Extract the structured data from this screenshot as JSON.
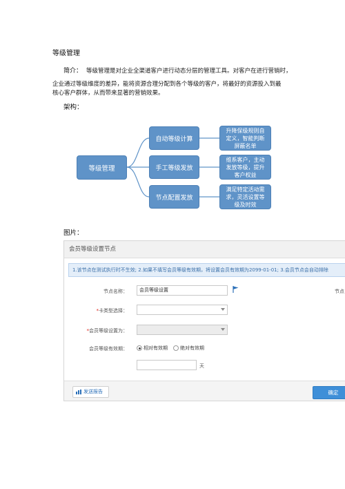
{
  "document": {
    "heading": "等级管理",
    "intro_label": "简介：",
    "intro_text": "等级管理是对企业全渠道客户进行动态分层的管理工具。对客户在进行营销时，",
    "body_lines": [
      "企业通过等级维度的差异，能将资源合理分配到各个等级的客户，将最好的资源投入到最",
      "核心客户群体，从而带来显著的营销效果。"
    ],
    "architecture_label": "架构：",
    "image_label": "图片："
  },
  "diagram": {
    "root": "等级管理",
    "branches": [
      {
        "label": "自动等级计算",
        "detail": [
          "升降保级规则自",
          "定义，智能判断",
          "屏蔽名单"
        ]
      },
      {
        "label": "手工等级发放",
        "detail": [
          "维系客户，主动",
          "发放等级，提升",
          "客户权益"
        ]
      },
      {
        "label": "节点配置发放",
        "detail": [
          "满足特定活动需",
          "求，灵活设置等",
          "级及时效"
        ]
      }
    ],
    "colors": {
      "node_fill": "#5f93c8",
      "node_border": "#4d80b6",
      "connector": "#5f93c8"
    }
  },
  "screenshot": {
    "title": "会员等级设置节点",
    "tip": "1.该节点在测试执行时不生效; 2.如果不填写会员等级有效期，将设置会员有效期为2099-01-01; 3.会员节点会自动排除",
    "fields": {
      "node_name_label": "节点名称：",
      "node_name_value": "会员等级设置",
      "node_right_label": "节点",
      "card_type_label": "卡类型选择：",
      "card_type_required": "*",
      "level_label": "会员等级设置为：",
      "level_required": "*",
      "validity_label": "会员等级有效期：",
      "radio_relative": "相对有效期",
      "radio_absolute": "绝对有效期",
      "days_unit": "天"
    },
    "buttons": {
      "report": "发送报告",
      "confirm": "确定"
    },
    "icons": {
      "flag": "flag-icon",
      "report": "chart-icon"
    },
    "colors": {
      "accent": "#3f8fd8",
      "tip_bg": "#e4eef9",
      "required": "#e2231a"
    }
  }
}
